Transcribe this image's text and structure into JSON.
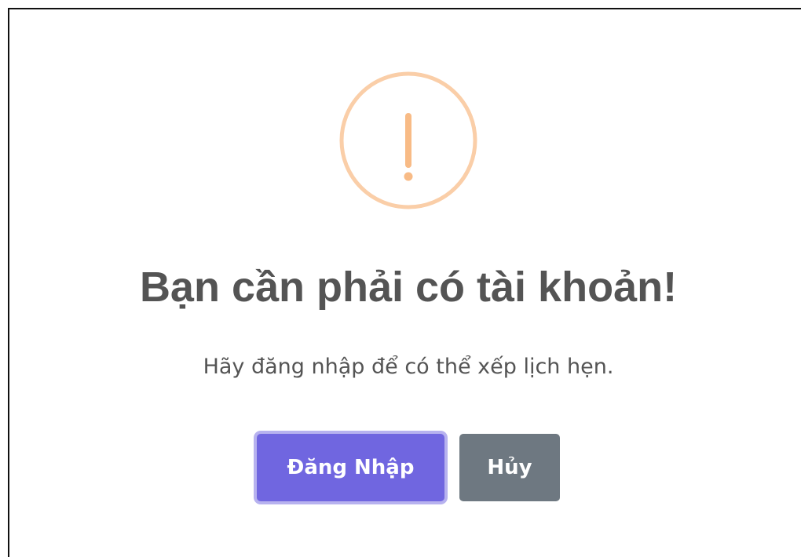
{
  "dialog": {
    "icon": "exclamation-warning-icon",
    "icon_color": "#f8bb86",
    "title": "Bạn cần phải có tài khoản!",
    "message": "Hãy đăng nhập để có thể xếp lịch hẹn.",
    "confirm_label": "Đăng Nhập",
    "cancel_label": "Hủy",
    "confirm_color": "#7066e0",
    "cancel_color": "#6e7881"
  }
}
